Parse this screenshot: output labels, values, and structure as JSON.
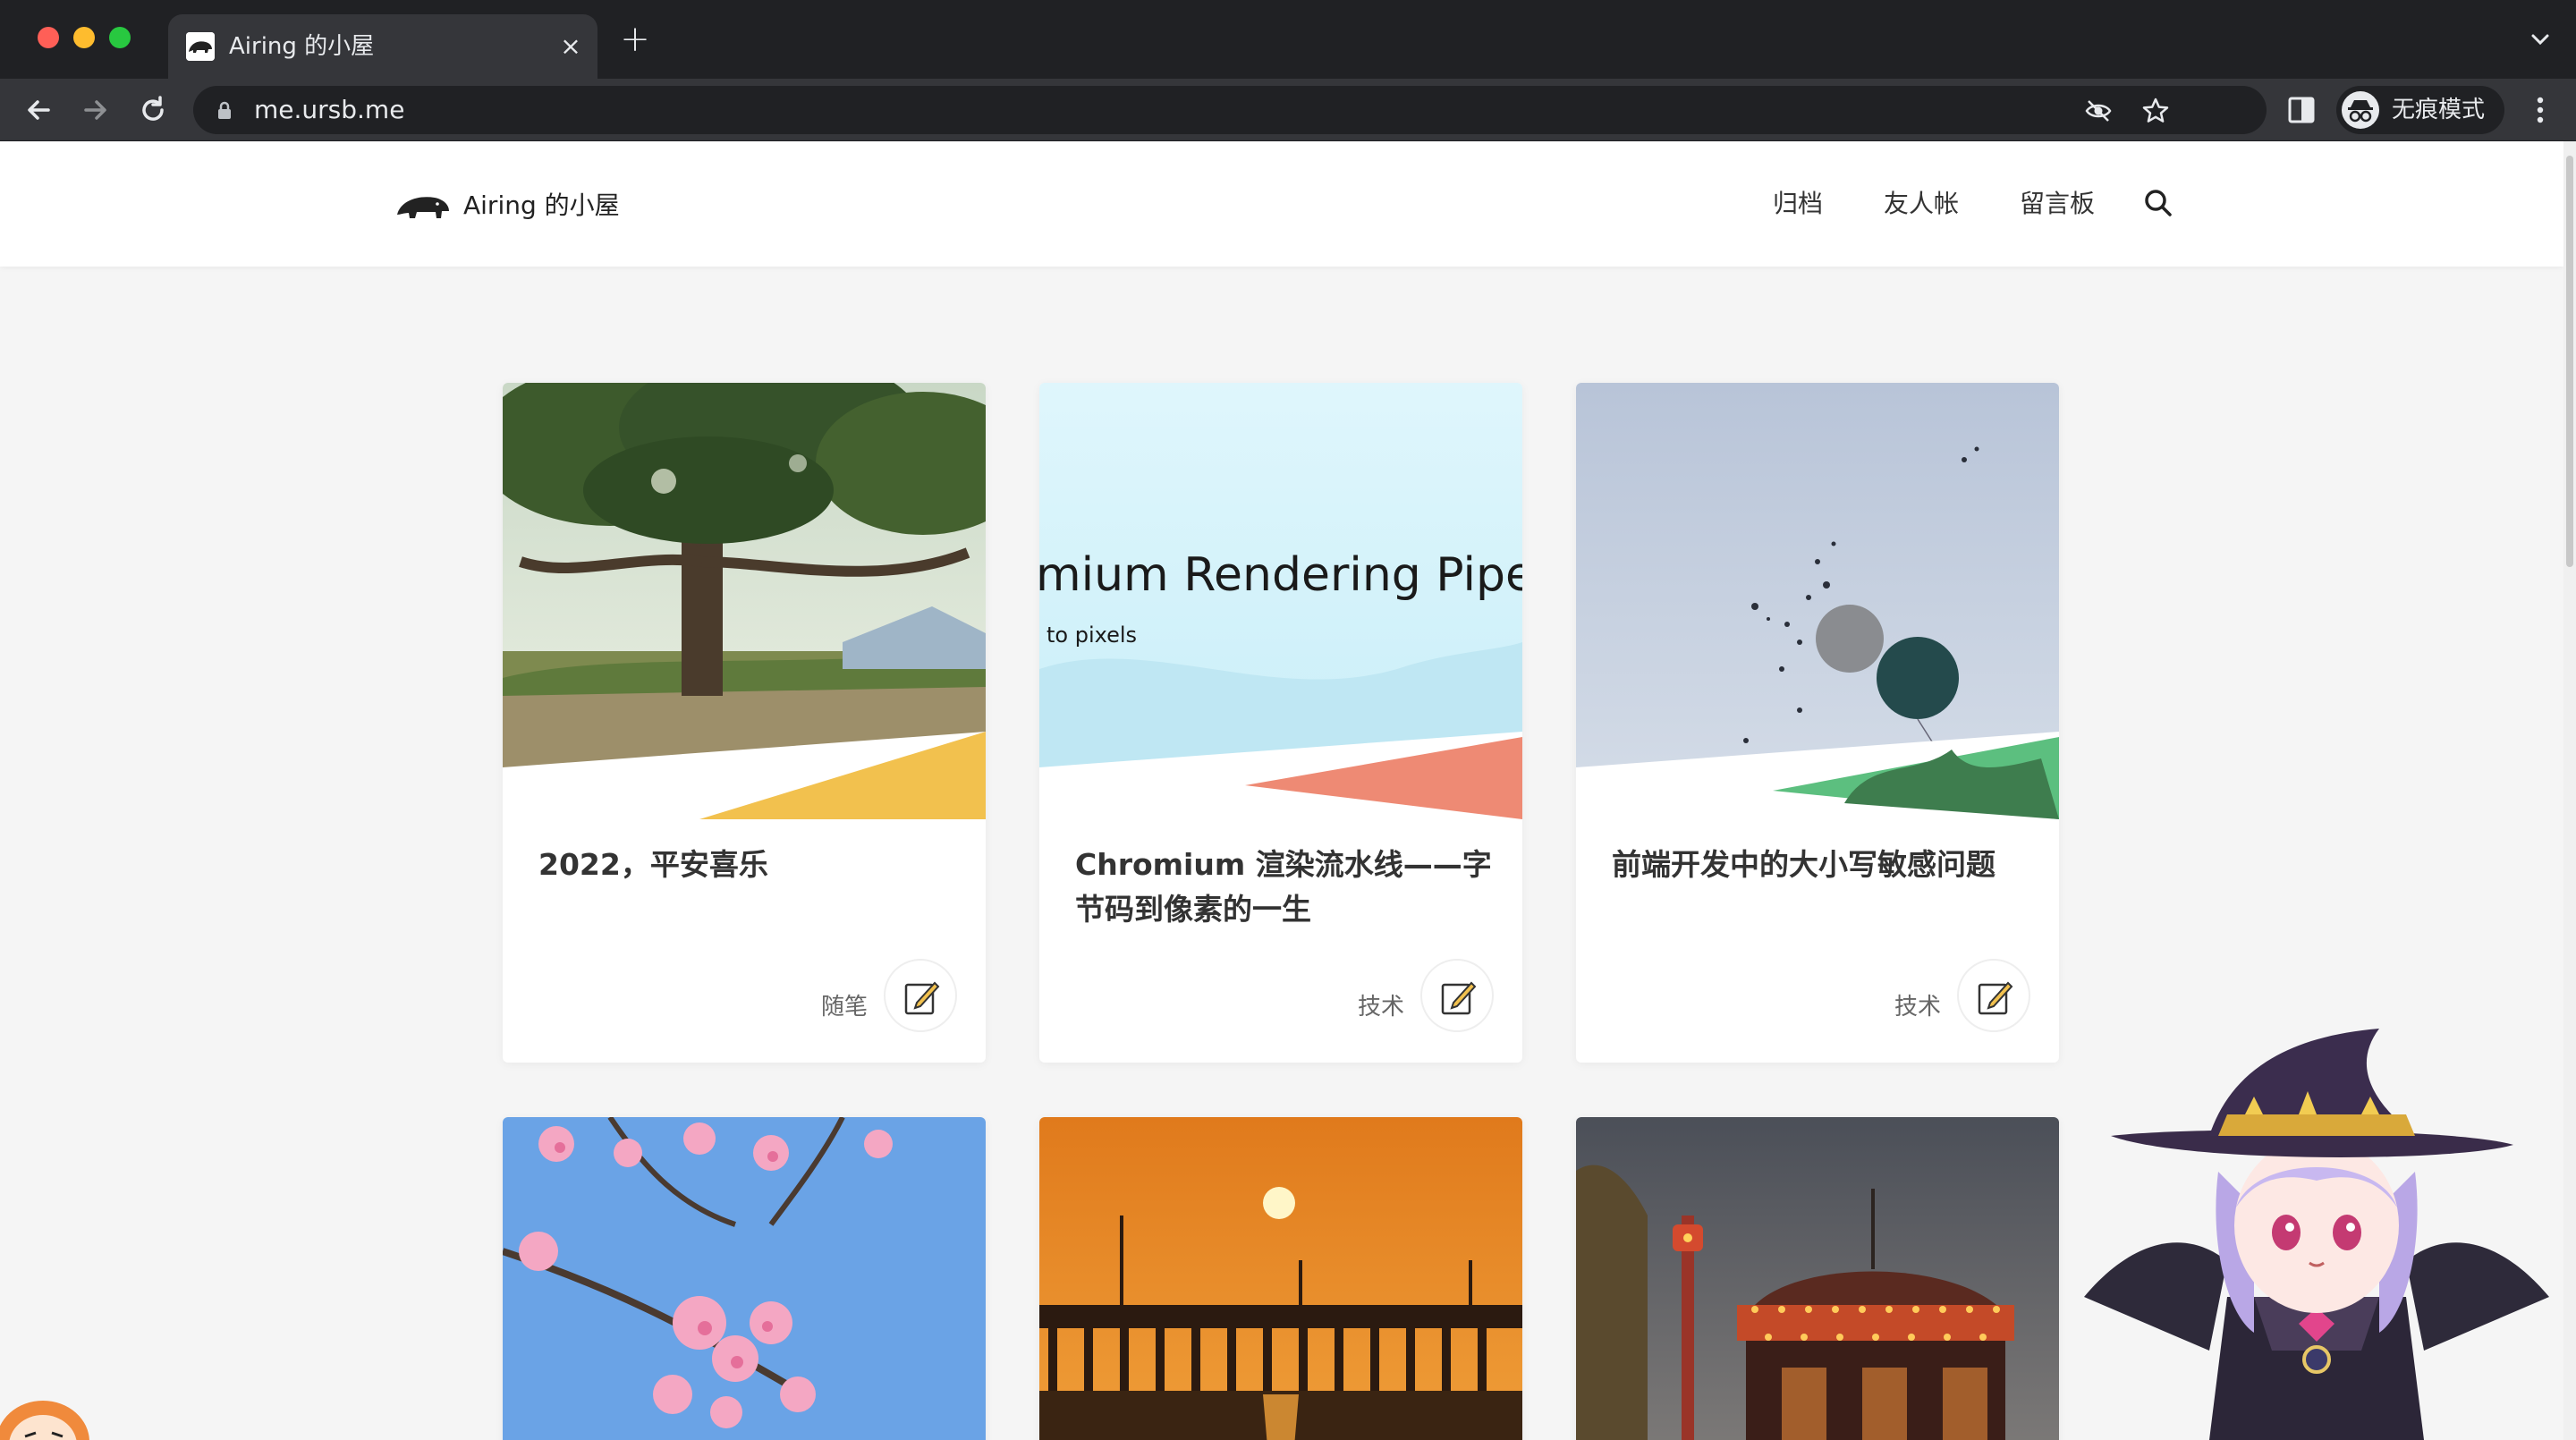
{
  "browser": {
    "tab_title": "Airing 的小屋",
    "tab_close": "×",
    "new_tab": "+",
    "url": "me.ursb.me",
    "profile_label": "无痕模式"
  },
  "site": {
    "logo_text": "Airing 的小屋",
    "nav": {
      "archive": "归档",
      "friends": "友人帐",
      "guestbook": "留言板"
    }
  },
  "posts": [
    {
      "title": "2022，平安喜乐",
      "category": "随笔"
    },
    {
      "title": "Chromium 渲染流水线——字节码到像素的一生",
      "category": "技术"
    },
    {
      "title": "前端开发中的大小写敏感问题",
      "category": "技术"
    }
  ],
  "cover_texts": {
    "chromium_heading": "mium Rendering Pipeli",
    "chromium_sub": "to pixels"
  },
  "colors": {
    "chrome_dark": "#202124",
    "chrome_mid": "#35363a",
    "page_bg": "#f5f5f5",
    "card_bg": "#ffffff",
    "accent_orange": "#f2c14e"
  }
}
